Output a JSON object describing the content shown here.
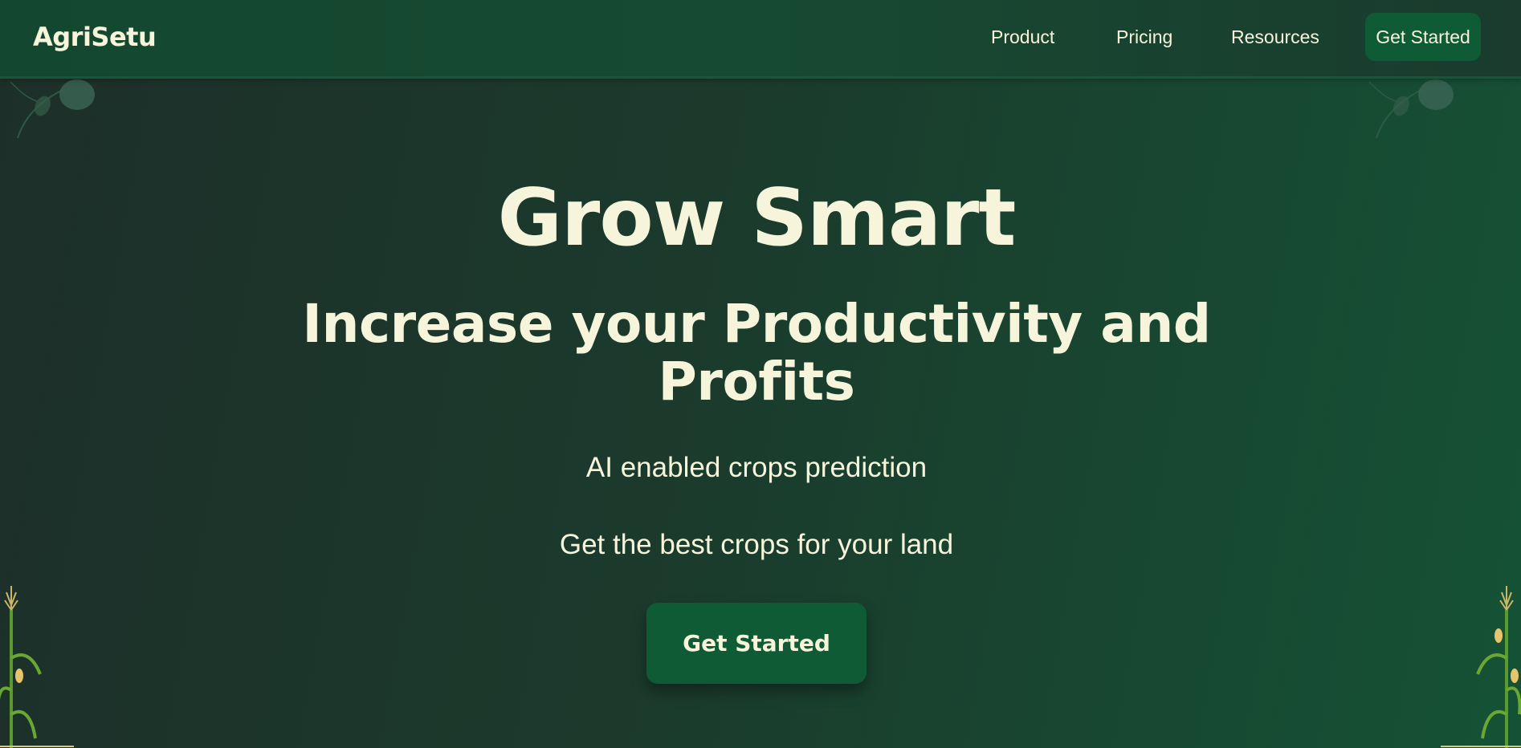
{
  "navbar": {
    "logo": "AgriSetu",
    "links": [
      {
        "label": "Product"
      },
      {
        "label": "Pricing"
      },
      {
        "label": "Resources"
      }
    ],
    "cta_label": "Get Started"
  },
  "hero": {
    "title": "Grow Smart",
    "subtitle": "Increase your Productivity and Profits",
    "line1": "AI enabled crops prediction",
    "line2": "Get the best crops for your land",
    "cta_label": "Get Started"
  },
  "colors": {
    "background_dark": "#1d2f29",
    "background_green": "#155235",
    "button_green": "#0e5b36",
    "text_cream": "#f6f5dc"
  },
  "icons": [
    "leaf-sprig-icon",
    "corn-plant-icon"
  ]
}
